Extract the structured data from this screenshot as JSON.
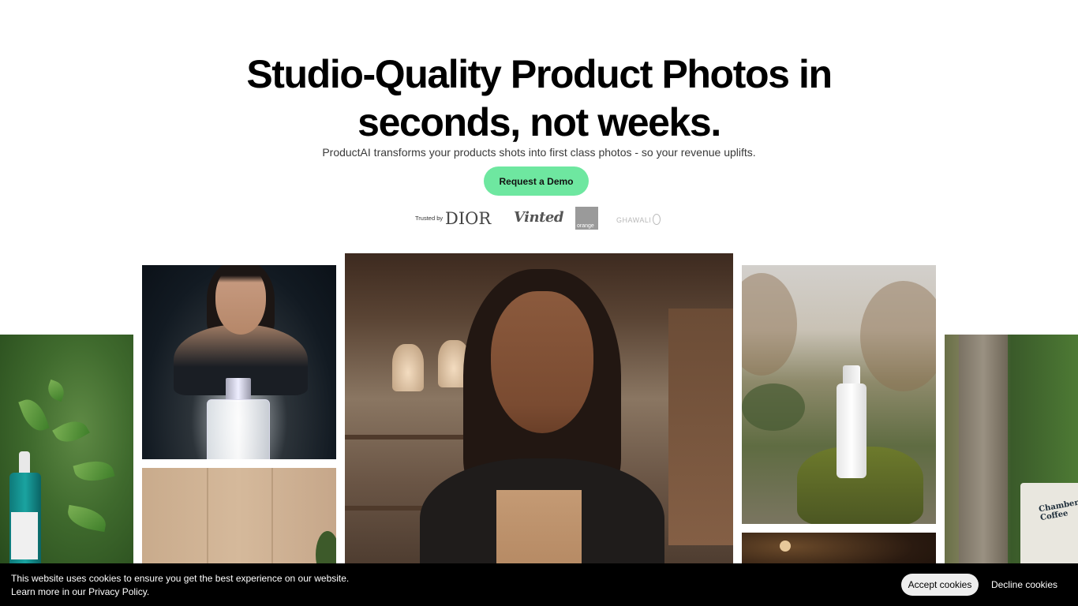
{
  "hero": {
    "title_line1": "Studio-Quality Product Photos in",
    "title_line2": "seconds, not weeks.",
    "subtitle": "ProductAI transforms your products shots into first class photos - so your revenue uplifts.",
    "cta_label": "Request a Demo"
  },
  "logos": {
    "trusted_label": "Trusted by",
    "items": [
      "DIOR",
      "Vinted",
      "orange",
      "GHAWALI"
    ]
  },
  "gallery": {
    "images": [
      {
        "name": "serum-green-leaves"
      },
      {
        "name": "perfume-woman"
      },
      {
        "name": "beige-wall"
      },
      {
        "name": "woman-coffee-shop"
      },
      {
        "name": "serum-moss"
      },
      {
        "name": "dark-flower"
      },
      {
        "name": "coffee-bag"
      }
    ],
    "coffee_bag_text": "Chamber Coffee"
  },
  "cookie": {
    "line1": "This website uses cookies to ensure you get the best experience on our website.",
    "line2_prefix": "Learn more in our ",
    "policy_link": "Privacy Policy",
    "line2_suffix": ".",
    "accept_label": "Accept cookies",
    "decline_label": "Decline cookies"
  },
  "colors": {
    "cta_bg": "#6ee7a0",
    "cookie_bg": "#000000",
    "accept_bg": "#eeeeee"
  }
}
